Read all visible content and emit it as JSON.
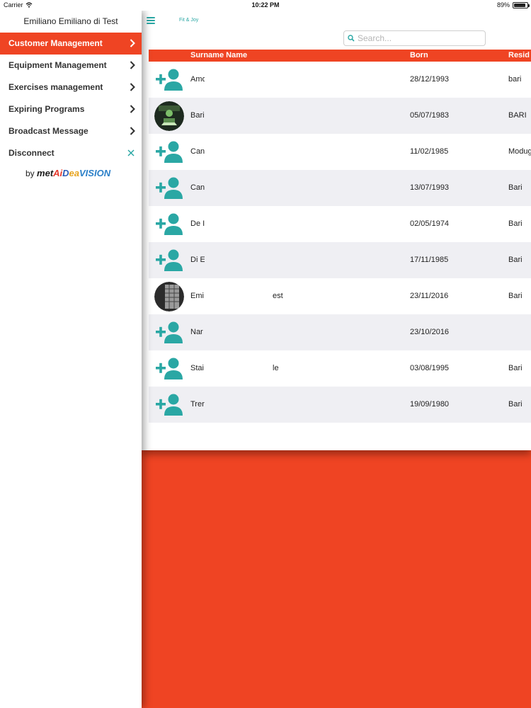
{
  "status_bar": {
    "carrier": "Carrier",
    "time": "10:22 PM",
    "battery": "89%",
    "battery_level": 0.89
  },
  "header": {
    "app_name": "Fit & Joy",
    "search_placeholder": "Search..."
  },
  "side_menu": {
    "user_name": "Emiliano Emiliano di Test",
    "items": [
      {
        "label": "Customer Management",
        "active": true
      },
      {
        "label": "Equipment Management"
      },
      {
        "label": "Exercises management"
      },
      {
        "label": "Expiring Programs"
      },
      {
        "label": "Broadcast Message"
      },
      {
        "label": "Disconnect"
      }
    ],
    "brand_by": "by",
    "brand_logo": [
      "met",
      "Ai",
      "D",
      "ea",
      "VISION"
    ]
  },
  "table": {
    "columns": [
      "Surname Name",
      "Born",
      "Resid"
    ],
    "rows": [
      {
        "name": "Amo",
        "name_tail": "",
        "born": "28/12/1993",
        "residence": "bari",
        "avatar": "add-user"
      },
      {
        "name": "Bari",
        "name_tail": "",
        "born": "05/07/1983",
        "residence": "BARI",
        "avatar": "photo"
      },
      {
        "name": "Can",
        "name_tail": "",
        "born": "11/02/1985",
        "residence": "Modug",
        "avatar": "add-user"
      },
      {
        "name": "Can",
        "name_tail": "",
        "born": "13/07/1993",
        "residence": "Bari",
        "avatar": "add-user"
      },
      {
        "name": "De I",
        "name_tail": "",
        "born": "02/05/1974",
        "residence": "Bari",
        "avatar": "add-user"
      },
      {
        "name": "Di E",
        "name_tail": "",
        "born": "17/11/1985",
        "residence": "Bari",
        "avatar": "add-user"
      },
      {
        "name": "Emi",
        "name_tail": "est",
        "born": "23/11/2016",
        "residence": "Bari",
        "avatar": "photo"
      },
      {
        "name": "Nar",
        "name_tail": "",
        "born": "23/10/2016",
        "residence": "",
        "avatar": "add-user"
      },
      {
        "name": "Stai",
        "name_tail": "le",
        "born": "03/08/1995",
        "residence": "Bari",
        "avatar": "add-user"
      },
      {
        "name": "Trer",
        "name_tail": "",
        "born": "19/09/1980",
        "residence": "Bari",
        "avatar": "add-user"
      }
    ]
  },
  "colors": {
    "accent": "#ef4423",
    "teal": "#2aa7a4",
    "row_alt": "#efeff3"
  }
}
